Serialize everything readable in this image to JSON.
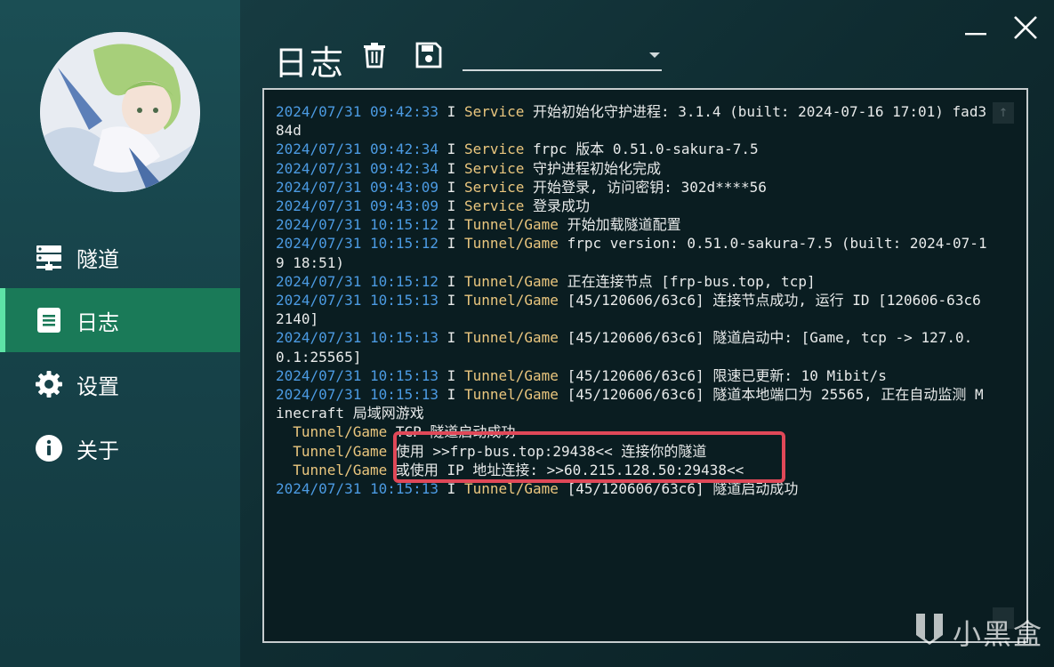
{
  "sidebar": {
    "items": [
      {
        "label": "隧道",
        "icon": "server-icon"
      },
      {
        "label": "日志",
        "icon": "document-icon"
      },
      {
        "label": "设置",
        "icon": "gear-icon"
      },
      {
        "label": "关于",
        "icon": "info-icon"
      }
    ],
    "active_index": 1
  },
  "header": {
    "title": "日志",
    "select_value": ""
  },
  "log": {
    "lines": [
      {
        "ts": "2024/07/31 09:42:33",
        "level": "I",
        "tag": "Service",
        "msg": "开始初始化守护进程: 3.1.4 (built: 2024-07-16 17:01) fad384d"
      },
      {
        "ts": "2024/07/31 09:42:34",
        "level": "I",
        "tag": "Service",
        "msg": "frpc 版本 0.51.0-sakura-7.5"
      },
      {
        "ts": "2024/07/31 09:42:34",
        "level": "I",
        "tag": "Service",
        "msg": "守护进程初始化完成"
      },
      {
        "ts": "2024/07/31 09:43:09",
        "level": "I",
        "tag": "Service",
        "msg": "开始登录, 访问密钥: 302d****56"
      },
      {
        "ts": "2024/07/31 09:43:09",
        "level": "I",
        "tag": "Service",
        "msg": "登录成功"
      },
      {
        "ts": "2024/07/31 10:15:12",
        "level": "I",
        "tag": "Tunnel/Game",
        "msg": "开始加载隧道配置"
      },
      {
        "ts": "2024/07/31 10:15:12",
        "level": "I",
        "tag": "Tunnel/Game",
        "msg": "frpc version: 0.51.0-sakura-7.5 (built: 2024-07-19 18:51)"
      },
      {
        "ts": "2024/07/31 10:15:12",
        "level": "I",
        "tag": "Tunnel/Game",
        "msg": "正在连接节点 [frp-bus.top, tcp]"
      },
      {
        "ts": "2024/07/31 10:15:13",
        "level": "I",
        "tag": "Tunnel/Game",
        "msg": "[45/120606/63c6] 连接节点成功, 运行 ID [120606-63c62140]"
      },
      {
        "ts": "2024/07/31 10:15:13",
        "level": "I",
        "tag": "Tunnel/Game",
        "msg": "[45/120606/63c6] 隧道启动中: [Game, tcp -> 127.0.0.1:25565]"
      },
      {
        "ts": "2024/07/31 10:15:13",
        "level": "I",
        "tag": "Tunnel/Game",
        "msg": "[45/120606/63c6] 限速已更新: 10 Mibit/s"
      },
      {
        "ts": "2024/07/31 10:15:13",
        "level": "I",
        "tag": "Tunnel/Game",
        "msg": "[45/120606/63c6] 隧道本地端口为 25565, 正在自动监测 Minecraft 局域网游戏"
      },
      {
        "ts": "",
        "level": "",
        "tag": "  Tunnel/Game",
        "msg": "TCP 隧道启动成功"
      },
      {
        "ts": "",
        "level": "",
        "tag": "  Tunnel/Game",
        "msg": "使用 >>frp-bus.top:29438<< 连接你的隧道"
      },
      {
        "ts": "",
        "level": "",
        "tag": "  Tunnel/Game",
        "msg": "或使用 IP 地址连接: >>60.215.128.50:29438<<"
      },
      {
        "ts": "2024/07/31 10:15:13",
        "level": "I",
        "tag": "Tunnel/Game",
        "msg": "[45/120606/63c6] 隧道启动成功"
      }
    ]
  },
  "watermark": {
    "text": "小黑盒"
  },
  "colors": {
    "timestamp": "#4c9be3",
    "tag": "#eac67e",
    "active_nav": "#1a7a58",
    "accent": "#5de3a6",
    "highlight_border": "#e04858"
  }
}
